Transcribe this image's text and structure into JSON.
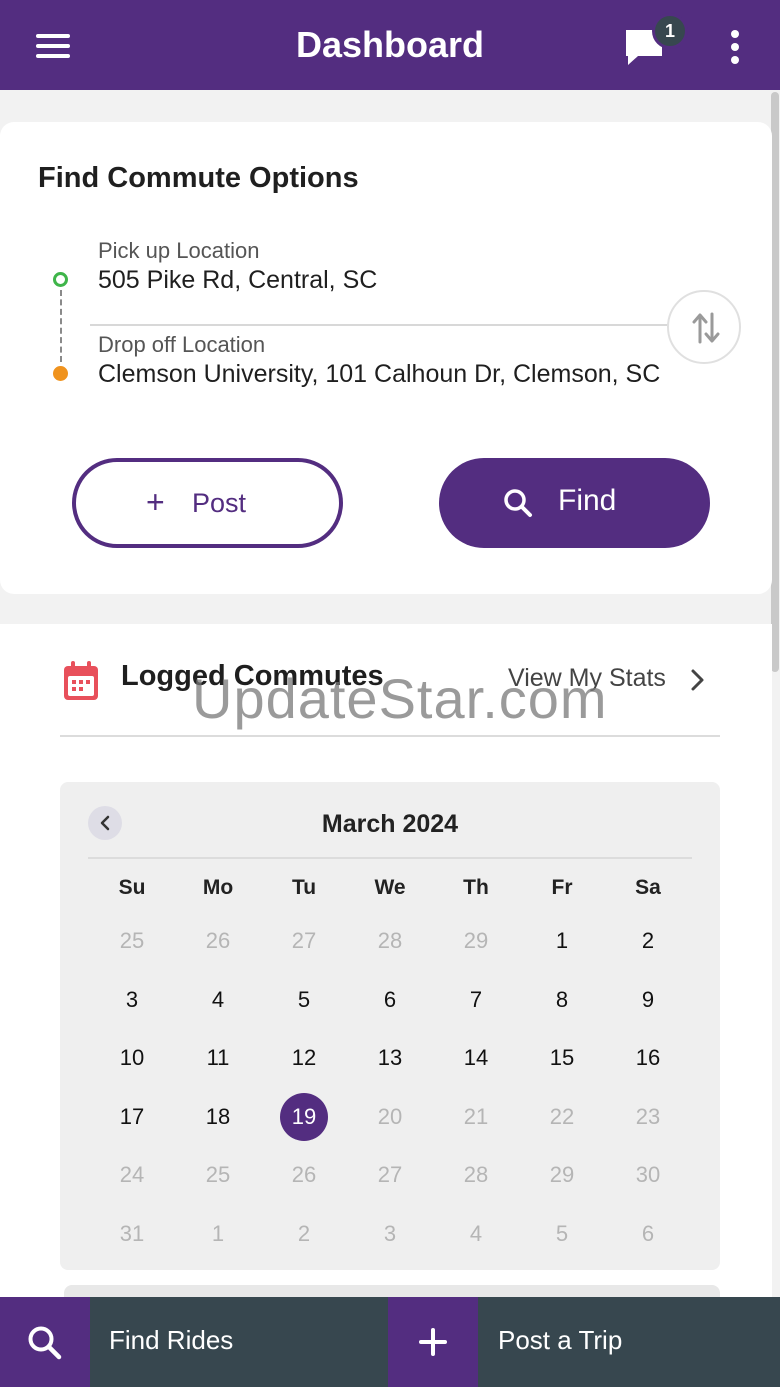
{
  "app": {
    "title": "Dashboard",
    "message_count": "1",
    "colors": {
      "primary": "#532d80",
      "dark": "#37474f",
      "pickup_dot": "#3fb54a",
      "dropoff_dot": "#f0931e",
      "accent_red": "#e8505b"
    }
  },
  "icons": {
    "menu": "hamburger-icon",
    "chat": "chat-bubble-icon",
    "more": "kebab-icon",
    "swap": "swap-arrows-icon",
    "calendar": "calendar-icon",
    "search": "search-icon",
    "add": "plus-icon"
  },
  "find": {
    "title": "Find Commute Options",
    "pickup_label": "Pick up Location",
    "pickup_value": "505 Pike Rd, Central, SC",
    "dropoff_label": "Drop off Location",
    "dropoff_value": "Clemson University, 101 Calhoun Dr, Clemson, SC",
    "post_label": "Post",
    "post_plus": "+",
    "find_label": "Find"
  },
  "logged": {
    "title": "Logged Commutes",
    "stats_link": "View My Stats"
  },
  "watermark": "UpdateStar.com",
  "calendar": {
    "month": "March 2024",
    "weekdays": [
      "Su",
      "Mo",
      "Tu",
      "We",
      "Th",
      "Fr",
      "Sa"
    ],
    "selected_day": "19",
    "days": [
      {
        "d": "25",
        "muted": true
      },
      {
        "d": "26",
        "muted": true
      },
      {
        "d": "27",
        "muted": true
      },
      {
        "d": "28",
        "muted": true
      },
      {
        "d": "29",
        "muted": true
      },
      {
        "d": "1",
        "muted": false
      },
      {
        "d": "2",
        "muted": false
      },
      {
        "d": "3",
        "muted": false
      },
      {
        "d": "4",
        "muted": false
      },
      {
        "d": "5",
        "muted": false
      },
      {
        "d": "6",
        "muted": false
      },
      {
        "d": "7",
        "muted": false
      },
      {
        "d": "8",
        "muted": false
      },
      {
        "d": "9",
        "muted": false
      },
      {
        "d": "10",
        "muted": false
      },
      {
        "d": "11",
        "muted": false
      },
      {
        "d": "12",
        "muted": false
      },
      {
        "d": "13",
        "muted": false
      },
      {
        "d": "14",
        "muted": false
      },
      {
        "d": "15",
        "muted": false
      },
      {
        "d": "16",
        "muted": false
      },
      {
        "d": "17",
        "muted": false
      },
      {
        "d": "18",
        "muted": false
      },
      {
        "d": "19",
        "muted": false,
        "selected": true
      },
      {
        "d": "20",
        "muted": true
      },
      {
        "d": "21",
        "muted": true
      },
      {
        "d": "22",
        "muted": true
      },
      {
        "d": "23",
        "muted": true
      },
      {
        "d": "24",
        "muted": true
      },
      {
        "d": "25",
        "muted": true
      },
      {
        "d": "26",
        "muted": true
      },
      {
        "d": "27",
        "muted": true
      },
      {
        "d": "28",
        "muted": true
      },
      {
        "d": "29",
        "muted": true
      },
      {
        "d": "30",
        "muted": true
      },
      {
        "d": "31",
        "muted": true
      },
      {
        "d": "1",
        "muted": true
      },
      {
        "d": "2",
        "muted": true
      },
      {
        "d": "3",
        "muted": true
      },
      {
        "d": "4",
        "muted": true
      },
      {
        "d": "5",
        "muted": true
      },
      {
        "d": "6",
        "muted": true
      }
    ]
  },
  "bottom": {
    "find_rides": "Find Rides",
    "post_trip": "Post a Trip"
  }
}
